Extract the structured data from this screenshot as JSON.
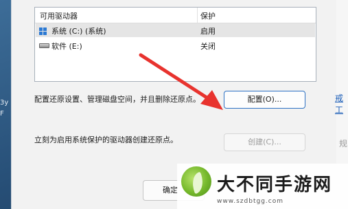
{
  "background": {
    "left_text_1": "3y",
    "left_text_2": "F"
  },
  "drive_table": {
    "col_drive": "可用驱动器",
    "col_protect": "保护",
    "rows": [
      {
        "name": "系统 (C:) (系统)",
        "protection": "启用",
        "icon": "windows-drive-icon",
        "selected": true
      },
      {
        "name": "软件 (E:)",
        "protection": "关闭",
        "icon": "drive-icon",
        "selected": false
      }
    ]
  },
  "configure": {
    "description": "配置还原设置、管理磁盘空间，并且删除还原点。",
    "button_label": "配置(O)..."
  },
  "create": {
    "description": "立刻为启用系统保护的驱动器创建还原点。",
    "button_label": "创建(C)..."
  },
  "ok_button": {
    "label": "确定"
  },
  "side": {
    "link_text": "戒工",
    "gray_text": "规"
  },
  "watermark": {
    "title": "大不同手游网",
    "url": "www.szdbtgg.com"
  },
  "colors": {
    "accent": "#2b6fc1",
    "arrow": "#e8332e",
    "selected_row": "#e5e5e5"
  }
}
